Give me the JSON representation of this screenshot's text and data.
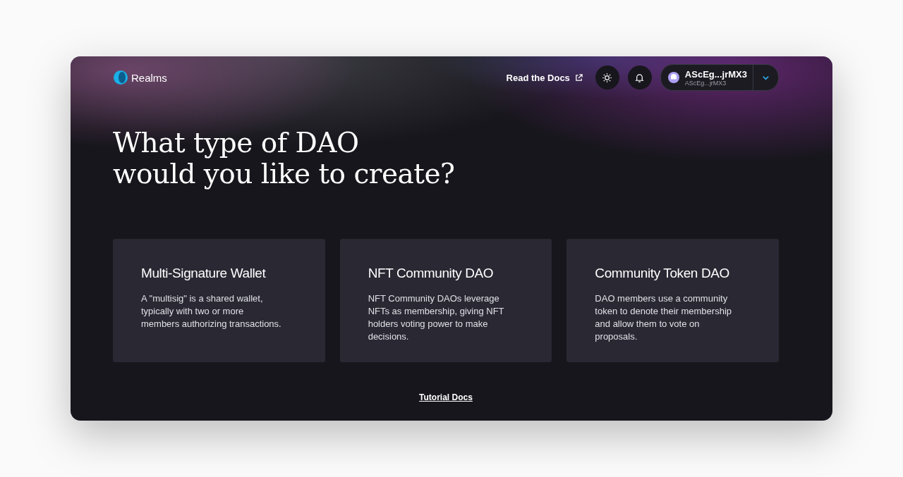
{
  "header": {
    "brand": "Realms",
    "docs_link": "Read the Docs",
    "wallet": {
      "name": "AScEg...jrMX3",
      "address": "AScEg...jrMX3"
    }
  },
  "heading": [
    "What type of DAO",
    "would you like to create?"
  ],
  "cards": [
    {
      "title": "Multi-Signature Wallet",
      "description": "A \"multisig\" is a shared wallet, typically with two or more members authorizing transactions."
    },
    {
      "title": "NFT Community DAO",
      "description": "NFT Community DAOs leverage NFTs as membership, giving NFT holders voting power to make decisions."
    },
    {
      "title": "Community Token DAO",
      "description": "DAO members use a community token to denote their membership and allow them to vote on proposals."
    }
  ],
  "footer_link": "Tutorial Docs"
}
